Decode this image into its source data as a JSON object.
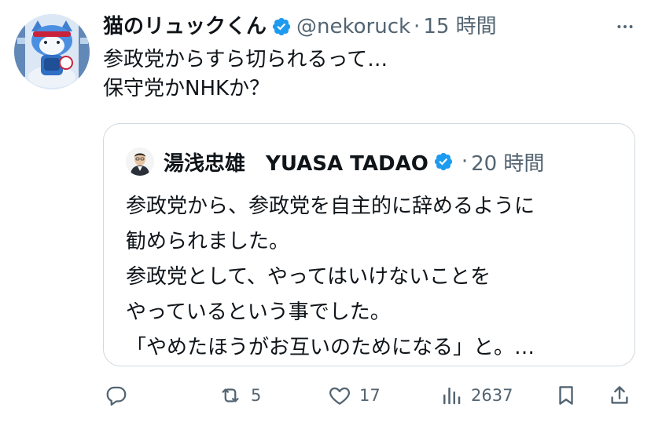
{
  "tweet": {
    "display_name": "猫のリュックくん",
    "handle": "@nekoruck",
    "separator": "·",
    "time": "15 時間",
    "text_lines": [
      "参政党からすら切られるって…",
      "保守党かNHKか？"
    ]
  },
  "quote": {
    "display_name": "湯浅忠雄　YUASA TADAO",
    "separator": "·",
    "time": "20 時間",
    "text_lines": [
      "参政党から、参政党を自主的に辞めるように",
      "勧められました。",
      "参政党として、やってはいけないことを",
      "やっているという事でした。",
      "「やめたほうがお互いのためになる」と。…"
    ]
  },
  "actions": {
    "reply_count": "",
    "retweet_count": "5",
    "like_count": "17",
    "views_count": "2637"
  },
  "colors": {
    "text": "#0f1419",
    "muted": "#536471",
    "verified": "#1d9bf0",
    "border": "#cfd9de"
  }
}
